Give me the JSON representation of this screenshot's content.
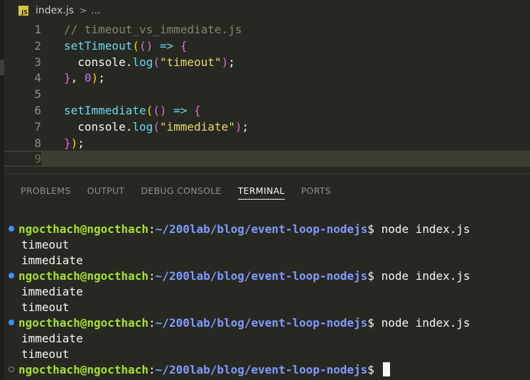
{
  "breadcrumb": {
    "icon_text": "JS",
    "file": "index.js",
    "separator": ">",
    "more": "..."
  },
  "editor": {
    "lines": [
      {
        "n": "1",
        "tokens": [
          {
            "t": "// timeout_vs_immediate.js",
            "c": "c-comment"
          }
        ]
      },
      {
        "n": "2",
        "tokens": [
          {
            "t": "setTimeout",
            "c": "c-fn"
          },
          {
            "t": "(",
            "c": "c-paren1"
          },
          {
            "t": "()",
            "c": "c-paren2"
          },
          {
            "t": " ",
            "c": "c-punct"
          },
          {
            "t": "=>",
            "c": "c-arrow"
          },
          {
            "t": " ",
            "c": "c-punct"
          },
          {
            "t": "{",
            "c": "c-brace"
          }
        ]
      },
      {
        "n": "3",
        "tokens": [
          {
            "t": "  console.",
            "c": "c-obj"
          },
          {
            "t": "log",
            "c": "c-fn"
          },
          {
            "t": "(",
            "c": "c-paren2"
          },
          {
            "t": "\"timeout\"",
            "c": "c-str"
          },
          {
            "t": ")",
            "c": "c-paren2"
          },
          {
            "t": ";",
            "c": "c-punct"
          }
        ]
      },
      {
        "n": "4",
        "tokens": [
          {
            "t": "}",
            "c": "c-brace"
          },
          {
            "t": ", ",
            "c": "c-punct"
          },
          {
            "t": "0",
            "c": "c-num"
          },
          {
            "t": ")",
            "c": "c-paren1"
          },
          {
            "t": ";",
            "c": "c-punct"
          }
        ]
      },
      {
        "n": "5",
        "tokens": []
      },
      {
        "n": "6",
        "tokens": [
          {
            "t": "setImmediate",
            "c": "c-fn"
          },
          {
            "t": "(",
            "c": "c-paren1"
          },
          {
            "t": "()",
            "c": "c-paren2"
          },
          {
            "t": " ",
            "c": "c-punct"
          },
          {
            "t": "=>",
            "c": "c-arrow"
          },
          {
            "t": " ",
            "c": "c-punct"
          },
          {
            "t": "{",
            "c": "c-brace"
          }
        ]
      },
      {
        "n": "7",
        "tokens": [
          {
            "t": "  console.",
            "c": "c-obj"
          },
          {
            "t": "log",
            "c": "c-fn"
          },
          {
            "t": "(",
            "c": "c-paren2"
          },
          {
            "t": "\"immediate\"",
            "c": "c-str"
          },
          {
            "t": ")",
            "c": "c-paren2"
          },
          {
            "t": ";",
            "c": "c-punct"
          }
        ]
      },
      {
        "n": "8",
        "tokens": [
          {
            "t": "}",
            "c": "c-brace"
          },
          {
            "t": ")",
            "c": "c-paren1"
          },
          {
            "t": ";",
            "c": "c-punct"
          }
        ]
      },
      {
        "n": "9",
        "tokens": [],
        "active": true
      }
    ]
  },
  "panel": {
    "tabs": [
      "PROBLEMS",
      "OUTPUT",
      "DEBUG CONSOLE",
      "TERMINAL",
      "PORTS"
    ],
    "active_tab": "TERMINAL"
  },
  "terminal": {
    "user": "ngocthach@ngocthach",
    "colon": ":",
    "path": "~/200lab/blog/event-loop-nodejs",
    "prompt_char": "$ ",
    "command": "node index.js",
    "runs": [
      {
        "output": [
          "timeout",
          "immediate"
        ]
      },
      {
        "output": [
          "immediate",
          "timeout"
        ]
      },
      {
        "output": [
          "immediate",
          "timeout"
        ]
      }
    ],
    "status_color": "#3794ff"
  }
}
